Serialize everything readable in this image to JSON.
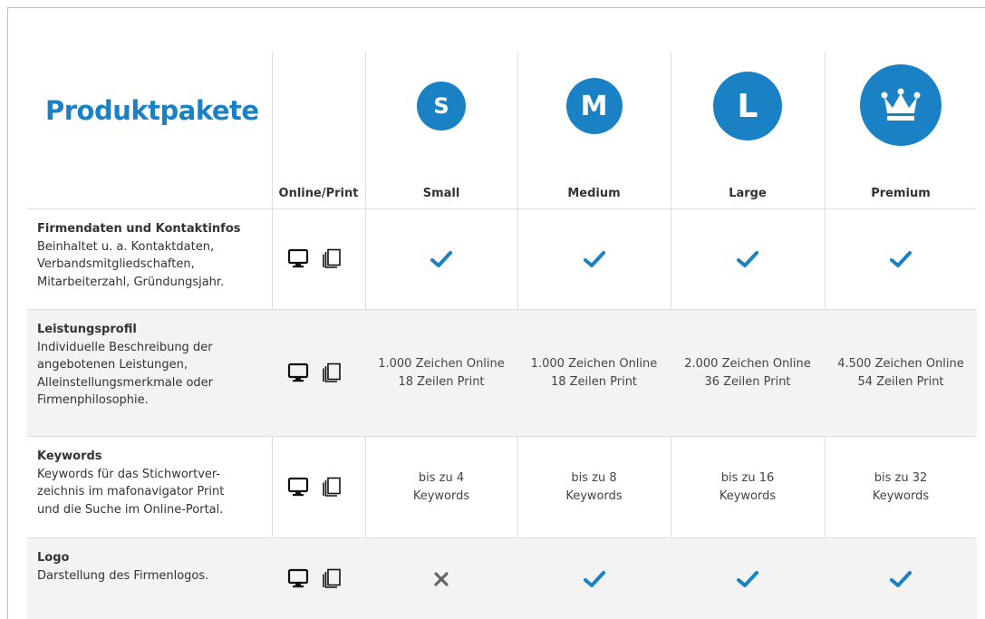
{
  "title": "Produktpakete",
  "accent_color": "#1a82c4",
  "columns": {
    "media_header": "Online/Print",
    "packages": [
      {
        "badge": "S",
        "label": "Small",
        "badge_type": "letter"
      },
      {
        "badge": "M",
        "label": "Medium",
        "badge_type": "letter"
      },
      {
        "badge": "L",
        "label": "Large",
        "badge_type": "letter"
      },
      {
        "badge": "crown-icon",
        "label": "Premium",
        "badge_type": "icon"
      }
    ]
  },
  "rows": [
    {
      "title": "Firmendaten und Kontaktinfos",
      "desc": "Beinhaltet u. a. Kontaktdaten,\nVerbandsmitgliedschaften,\nMitarbeiterzahl, Gründungsjahr.",
      "media": [
        "monitor-icon",
        "print-icon"
      ],
      "cells": [
        {
          "type": "check"
        },
        {
          "type": "check"
        },
        {
          "type": "check"
        },
        {
          "type": "check"
        }
      ]
    },
    {
      "title": "Leistungsprofil",
      "desc": "Individuelle Beschreibung der\nangebotenen Leistungen,\nAlleinstellungsmerkmale oder\nFirmenphilosophie.",
      "media": [
        "monitor-icon",
        "print-icon"
      ],
      "cells": [
        {
          "type": "text",
          "line1": "1.000 Zeichen Online",
          "line2": "18 Zeilen Print"
        },
        {
          "type": "text",
          "line1": "1.000 Zeichen Online",
          "line2": "18 Zeilen Print"
        },
        {
          "type": "text",
          "line1": "2.000 Zeichen Online",
          "line2": "36 Zeilen Print"
        },
        {
          "type": "text",
          "line1": "4.500 Zeichen Online",
          "line2": "54 Zeilen Print"
        }
      ]
    },
    {
      "title": "Keywords",
      "desc": "Keywords für das Stichwortver-\nzeichnis im mafonavigator Print\nund die Suche im Online-Portal.",
      "media": [
        "monitor-icon",
        "print-icon"
      ],
      "cells": [
        {
          "type": "text",
          "line1": "bis zu 4",
          "line2": "Keywords"
        },
        {
          "type": "text",
          "line1": "bis zu 8",
          "line2": "Keywords"
        },
        {
          "type": "text",
          "line1": "bis zu 16",
          "line2": "Keywords"
        },
        {
          "type": "text",
          "line1": "bis zu 32",
          "line2": "Keywords"
        }
      ]
    },
    {
      "title": "Logo",
      "desc": "Darstellung des Firmenlogos.",
      "media": [
        "monitor-icon",
        "print-icon"
      ],
      "cells": [
        {
          "type": "cross"
        },
        {
          "type": "check"
        },
        {
          "type": "check"
        },
        {
          "type": "check"
        }
      ]
    }
  ]
}
